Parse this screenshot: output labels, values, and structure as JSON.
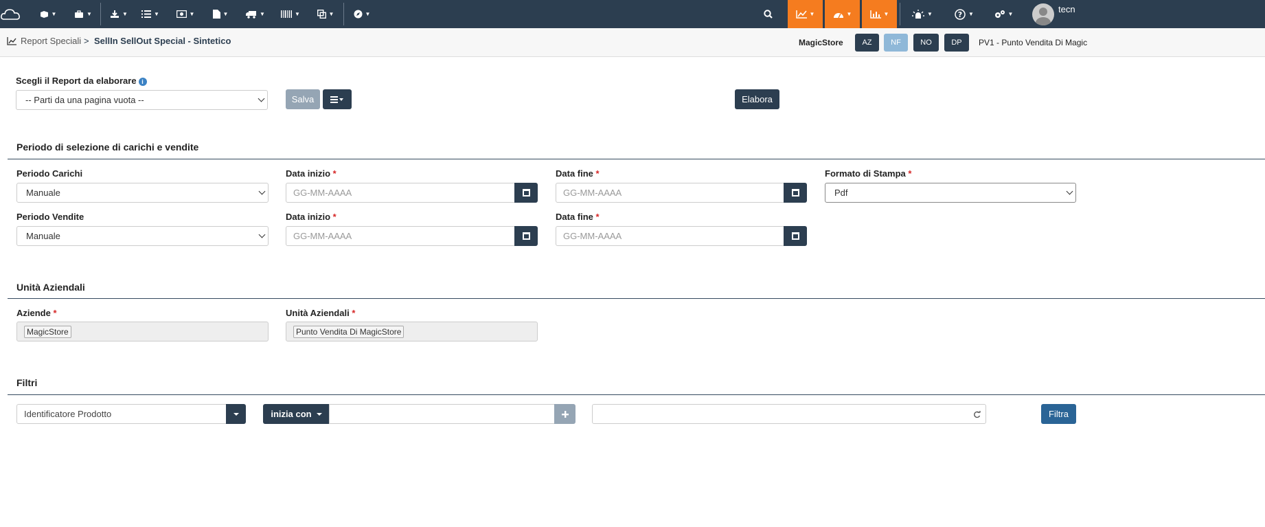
{
  "topbar": {
    "logo": "cloud-logo",
    "nav_icons": [
      "box-icon",
      "briefcase-icon",
      "download-icon",
      "list-icon",
      "money-icon",
      "file-icon",
      "truck-icon",
      "barcode-icon",
      "copy-icon",
      "compass-icon"
    ],
    "right_icons": [
      "search-icon",
      "line-chart-icon",
      "dashboard-icon",
      "bar-chart-icon",
      "alarm-light-icon",
      "help-icon",
      "settings-icon"
    ],
    "user": "tecn",
    "accent": "#f57c1f",
    "bg": "#2c3e50"
  },
  "breadcrumb": {
    "parent": "Report Speciali",
    "separator": ">",
    "current": "SellIn SellOut Special - Sintetico"
  },
  "context": {
    "store": "MagicStore",
    "pills": [
      "AZ",
      "NF",
      "NO",
      "DP"
    ],
    "pv": "PV1 - Punto Vendita Di Magic"
  },
  "report": {
    "label": "Scegli il Report da elaborare",
    "info_icon": "i",
    "selected": "-- Parti da una pagina vuota --",
    "save": "Salva",
    "elabora": "Elabora"
  },
  "periodo": {
    "title": "Periodo di selezione di carichi e vendite",
    "carichi_label": "Periodo Carichi",
    "carichi_value": "Manuale",
    "vendite_label": "Periodo Vendite",
    "vendite_value": "Manuale",
    "data_inizio": "Data inizio",
    "data_fine": "Data fine",
    "required": "*",
    "date_placeholder": "GG-MM-AAAA",
    "formato_label": "Formato di Stampa",
    "formato_value": "Pdf"
  },
  "unita": {
    "title": "Unità Aziendali",
    "aziende_label": "Aziende",
    "aziende_tag": "MagicStore",
    "unita_label": "Unità Aziendali",
    "unita_tag": "Punto Vendita Di MagicStore"
  },
  "filtri": {
    "title": "Filtri",
    "field": "Identificatore Prodotto",
    "operator": "inizia con",
    "filtra": "Filtra"
  }
}
